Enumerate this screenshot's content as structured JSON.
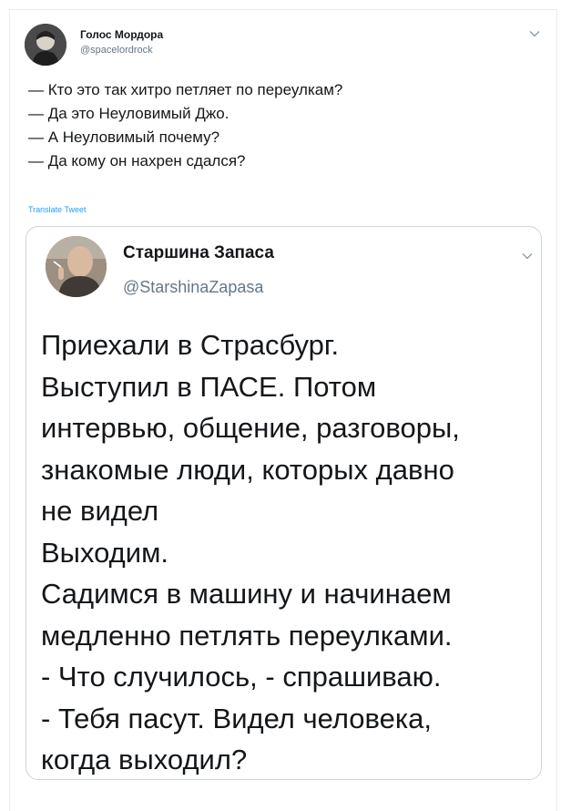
{
  "tweet": {
    "author_name": "Голос Мордора",
    "author_handle": "@spacelordrock",
    "lines": [
      "— Кто это так хитро петляет по переулкам?",
      "— Да это Неуловимый Джо.",
      "— А Неуловимый почему?",
      "— Да кому он нахрен сдался?"
    ],
    "translate_label": "Translate Tweet"
  },
  "quoted_tweet": {
    "author_name": "Старшина Запаса",
    "author_handle": "@StarshinaZapasa",
    "lines": [
      "Приехали в Страсбург.",
      "Выступил в ПАСЕ. Потом",
      "интервью, общение, разговоры,",
      "знакомые люди, которых давно",
      "не видел",
      "Выходим.",
      "Садимся в машину и начинаем",
      "медленно петлять переулками.",
      "- Что случилось, - спрашиваю.",
      "- Тебя пасут. Видел человека,",
      "когда выходил?"
    ]
  },
  "colors": {
    "text": "#14171a",
    "secondary": "#657786",
    "link": "#1da1f2",
    "border": "#e6ecf0"
  }
}
